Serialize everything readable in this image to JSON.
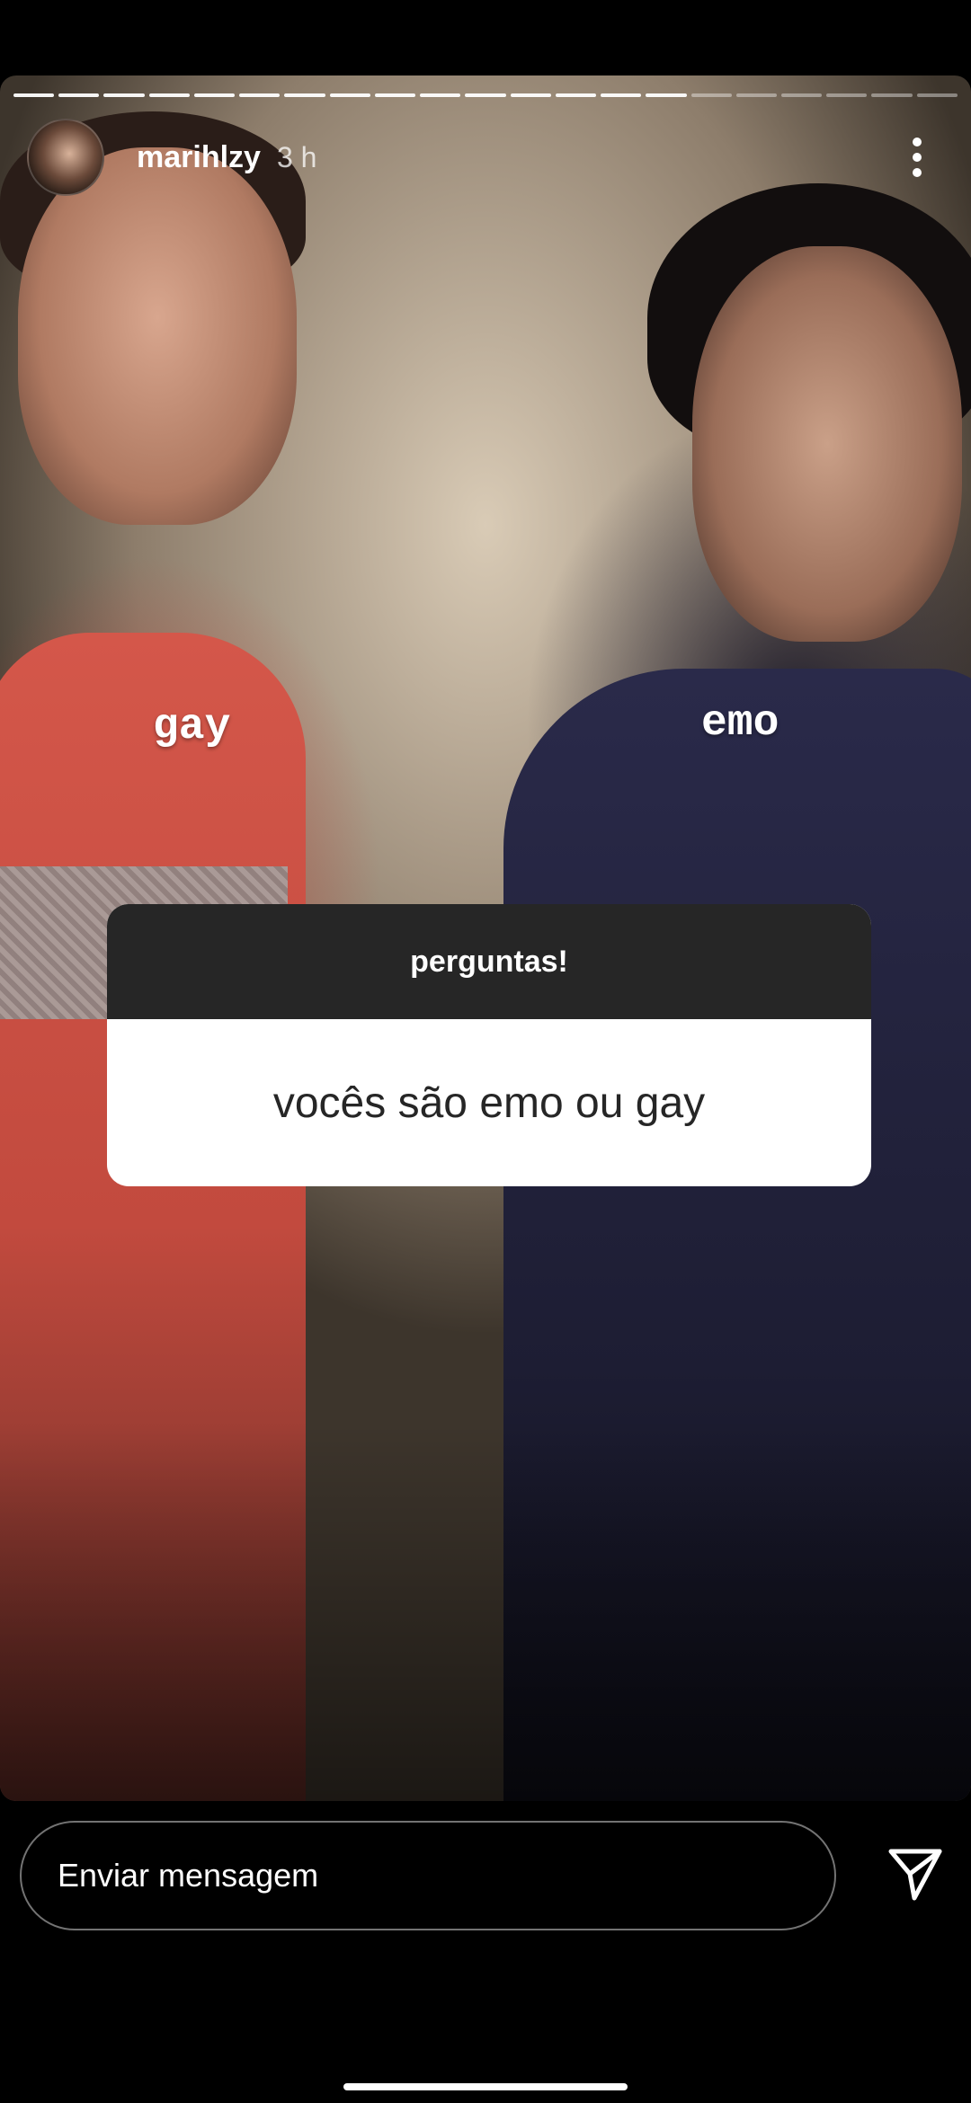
{
  "story": {
    "segments_total": 21,
    "segments_completed": 15,
    "user": {
      "username": "marihlzy",
      "time": "3 h"
    },
    "stickers": {
      "left": "gay",
      "right": "emo"
    },
    "question_card": {
      "title": "perguntas!",
      "question": "vocês são emo ou gay"
    }
  },
  "reply_bar": {
    "placeholder": "Enviar mensagem"
  },
  "icons": {
    "more": "more-vertical-icon",
    "send": "send-icon"
  },
  "colors": {
    "card_header": "#262626",
    "card_body": "#ffffff",
    "background": "#000000"
  }
}
